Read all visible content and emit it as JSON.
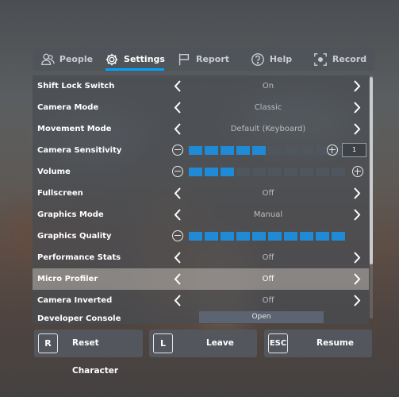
{
  "tabs": [
    {
      "label": "People",
      "icon": "people-icon"
    },
    {
      "label": "Settings",
      "icon": "gear-icon",
      "active": true
    },
    {
      "label": "Report",
      "icon": "flag-icon"
    },
    {
      "label": "Help",
      "icon": "help-icon"
    },
    {
      "label": "Record",
      "icon": "record-icon"
    }
  ],
  "settings": {
    "shift_lock": {
      "label": "Shift Lock Switch",
      "value": "On"
    },
    "camera_mode": {
      "label": "Camera Mode",
      "value": "Classic"
    },
    "movement_mode": {
      "label": "Movement Mode",
      "value": "Default (Keyboard)"
    },
    "camera_sensitivity": {
      "label": "Camera Sensitivity",
      "level": 5,
      "max": 10,
      "value": "1"
    },
    "volume": {
      "label": "Volume",
      "level": 3,
      "max": 10
    },
    "fullscreen": {
      "label": "Fullscreen",
      "value": "Off"
    },
    "graphics_mode": {
      "label": "Graphics Mode",
      "value": "Manual"
    },
    "graphics_quality": {
      "label": "Graphics Quality",
      "level": 10,
      "max": 10
    },
    "performance_stats": {
      "label": "Performance Stats",
      "value": "Off"
    },
    "micro_profiler": {
      "label": "Micro Profiler",
      "value": "Off"
    },
    "camera_inverted": {
      "label": "Camera Inverted",
      "value": "Off"
    },
    "developer_console": {
      "label": "Developer Console",
      "button": "Open"
    }
  },
  "actions": {
    "reset": {
      "key": "R",
      "label": "Reset Character"
    },
    "leave": {
      "key": "L",
      "label": "Leave"
    },
    "resume": {
      "key": "ESC",
      "label": "Resume"
    }
  },
  "colors": {
    "accent": "#00a2ff",
    "slider_on": "#1f8ad6",
    "slider_off": "#50565e"
  }
}
